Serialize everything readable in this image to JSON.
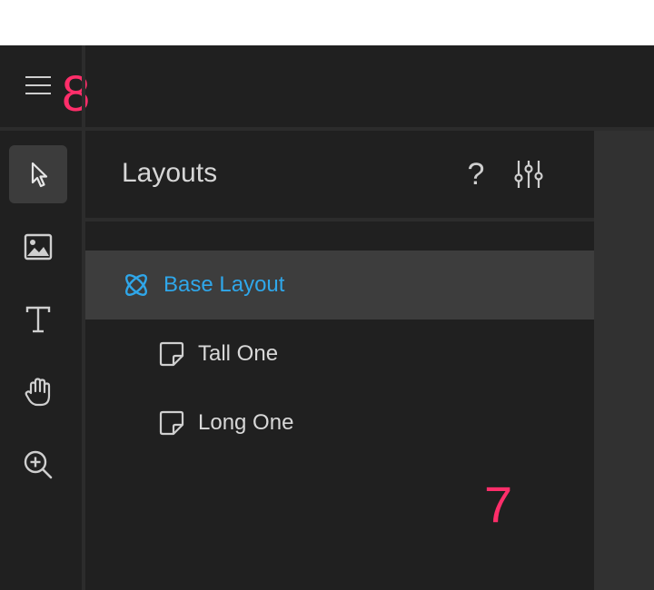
{
  "annotations": {
    "badge_top": "8",
    "badge_bottom": "7"
  },
  "colors": {
    "accent": "#2fa7ea",
    "badge": "#ff2e6a",
    "selected_bg": "#3d3d3d",
    "tool_active_bg": "#3c3c3c"
  },
  "toolbar": {
    "tools": [
      {
        "name": "select",
        "icon": "cursor-arrow-icon",
        "active": true
      },
      {
        "name": "image",
        "icon": "image-icon",
        "active": false
      },
      {
        "name": "text",
        "icon": "text-icon",
        "active": false
      },
      {
        "name": "pan",
        "icon": "hand-icon",
        "active": false
      },
      {
        "name": "zoom",
        "icon": "zoom-in-icon",
        "active": false
      }
    ]
  },
  "panel": {
    "title": "Layouts",
    "help_label": "?",
    "items": [
      {
        "label": "Base Layout",
        "icon": "atom-icon",
        "selected": true
      },
      {
        "label": "Tall One",
        "icon": "page-icon",
        "selected": false
      },
      {
        "label": "Long One",
        "icon": "page-icon",
        "selected": false
      }
    ]
  }
}
